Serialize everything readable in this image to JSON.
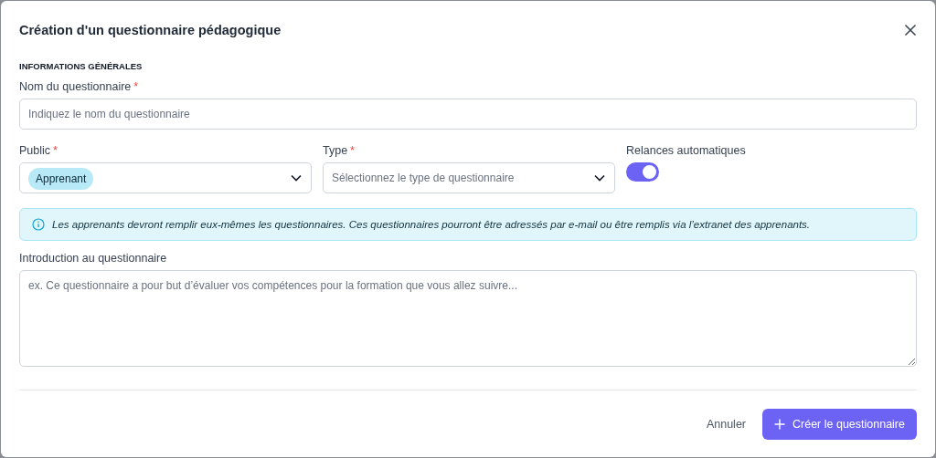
{
  "dialog": {
    "title": "Création d'un questionnaire pédagogique"
  },
  "section_heading": "INFORMATIONS GÉNÉRALES",
  "name_field": {
    "label": "Nom du questionnaire",
    "required_mark": "*",
    "placeholder": "Indiquez le nom du questionnaire"
  },
  "public_field": {
    "label": "Public",
    "required_mark": "*",
    "chips": [
      "Apprenant"
    ]
  },
  "type_field": {
    "label": "Type",
    "required_mark": "*",
    "placeholder": "Sélectionnez le type de questionnaire"
  },
  "reminders": {
    "label": "Relances automatiques",
    "on": true
  },
  "info": "Les apprenants devront remplir eux-mêmes les questionnaires. Ces questionnaires pourront être adressés par e-mail ou être remplis via l’extranet des apprenants.",
  "intro_field": {
    "label": "Introduction au questionnaire",
    "placeholder": "ex. Ce questionnaire a pour but d’évaluer vos compétences pour la formation que vous allez suivre..."
  },
  "buttons": {
    "cancel": "Annuler",
    "create": "Créer le questionnaire"
  }
}
